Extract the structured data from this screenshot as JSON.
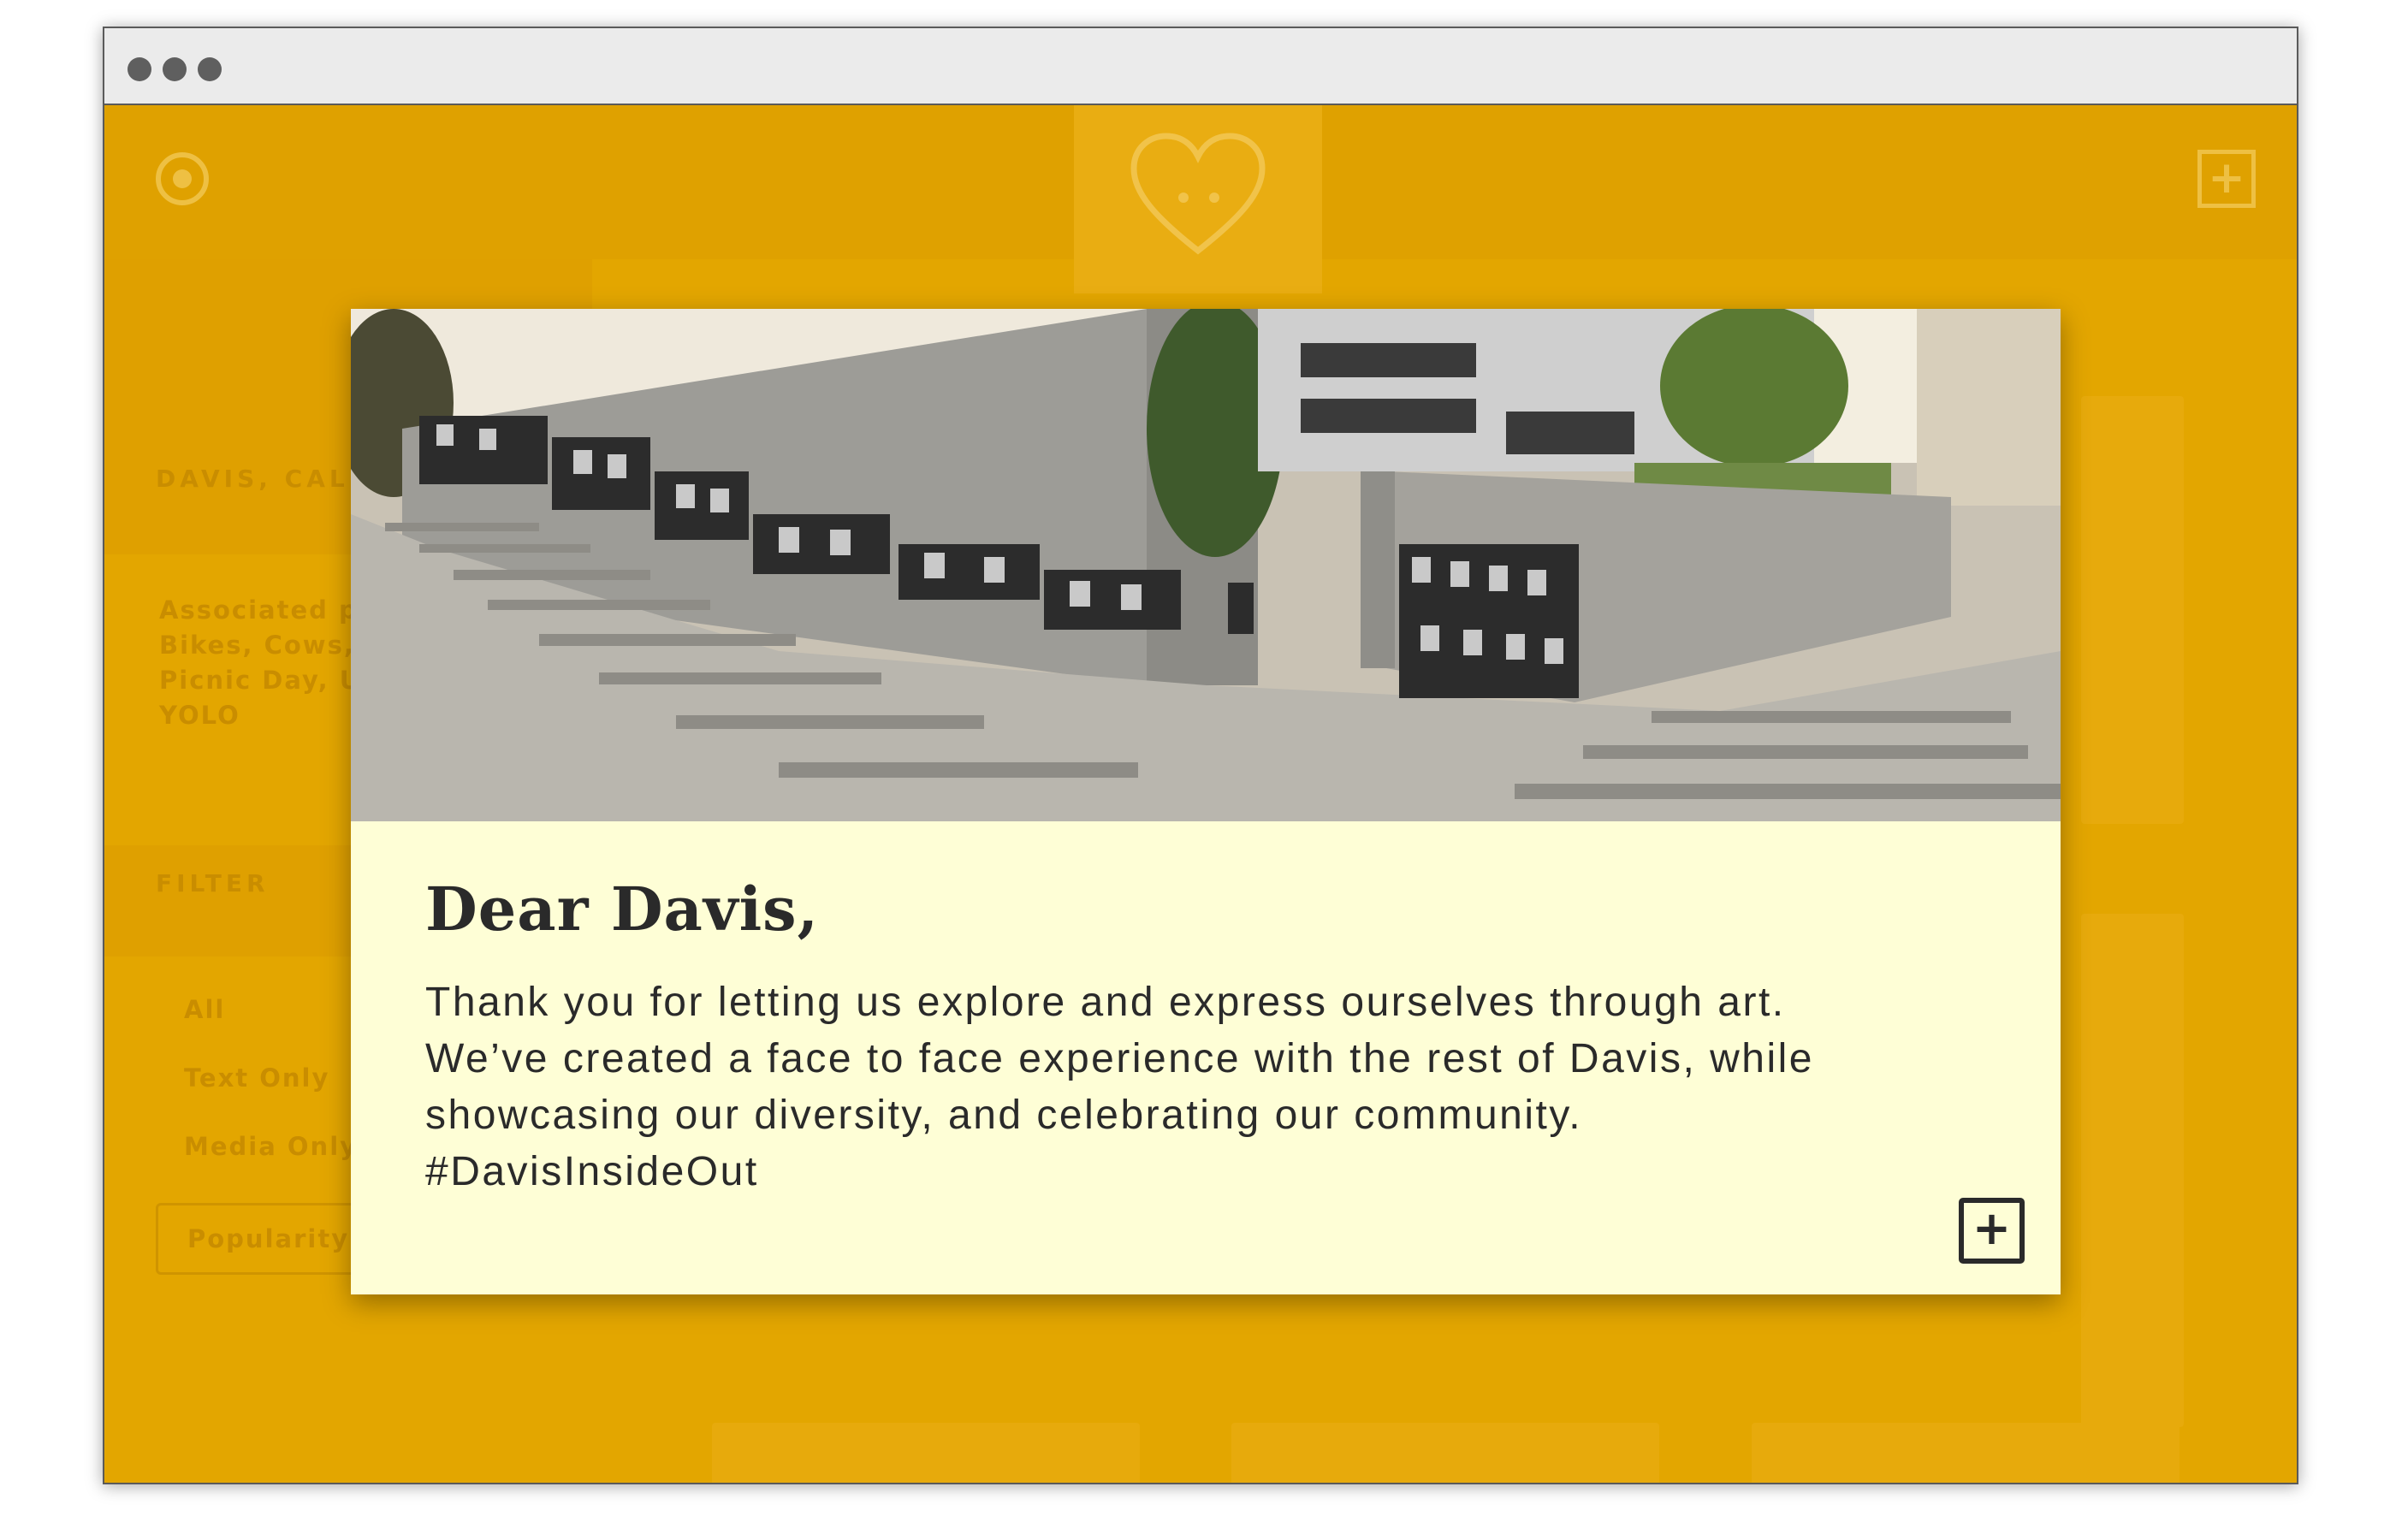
{
  "window": {
    "controls": [
      "close",
      "minimize",
      "zoom"
    ]
  },
  "header": {
    "logo_icon": "target-icon",
    "stamp_icon": "heart-icon",
    "add_icon": "plus-square-icon"
  },
  "sidebar": {
    "location": "DAVIS, CALI",
    "associated": [
      "Associated p",
      "Bikes, Cows,",
      "Picnic Day, U",
      "YOLO"
    ],
    "filter_title": "FILTER",
    "filters": [
      "All",
      "Text Only",
      "Media Only"
    ],
    "sort_label": "Popularity"
  },
  "modal": {
    "title": "Dear Davis,",
    "body": "Thank you for letting us explore and  express ourselves through art.\nWe’ve created a face to face experience with the rest of Davis, while\nshowcasing our diversity, and celebrating our community.\n#DavisInsideOut",
    "expand_icon": "plus-square-icon"
  },
  "colors": {
    "accent": "#e3a600",
    "modal_bg": "#fefed6",
    "text": "#2a2a2a"
  }
}
